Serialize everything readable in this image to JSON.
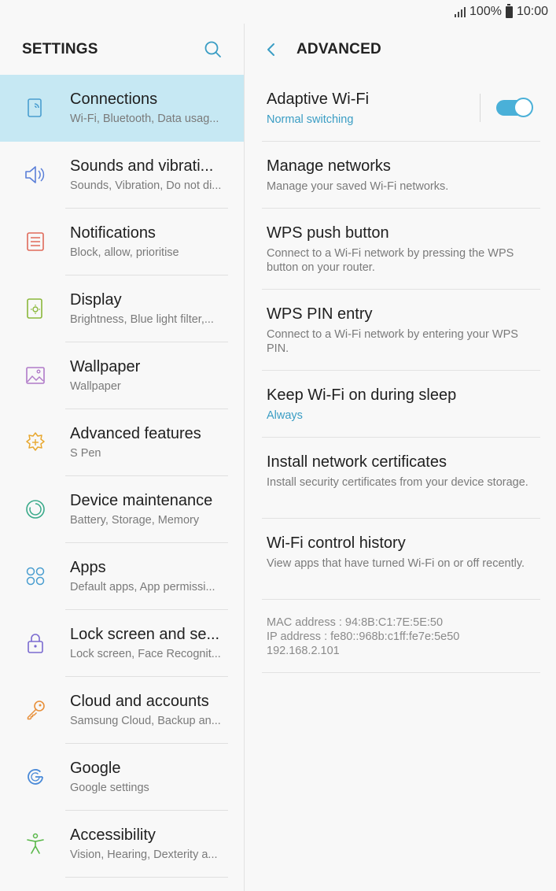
{
  "status_bar": {
    "battery_percent": "100%",
    "time": "10:00"
  },
  "left_panel": {
    "title": "SETTINGS",
    "items": [
      {
        "title": "Connections",
        "subtitle": "Wi-Fi, Bluetooth, Data usag...",
        "icon": "connections-icon",
        "icon_color": "#4a9ed0",
        "selected": true
      },
      {
        "title": "Sounds and vibrati...",
        "subtitle": "Sounds, Vibration, Do not di...",
        "icon": "speaker-icon",
        "icon_color": "#5a7fd8"
      },
      {
        "title": "Notifications",
        "subtitle": "Block, allow, prioritise",
        "icon": "notifications-icon",
        "icon_color": "#e06a5a"
      },
      {
        "title": "Display",
        "subtitle": "Brightness, Blue light filter,...",
        "icon": "display-icon",
        "icon_color": "#8ab83a"
      },
      {
        "title": "Wallpaper",
        "subtitle": "Wallpaper",
        "icon": "wallpaper-icon",
        "icon_color": "#b07ac8"
      },
      {
        "title": "Advanced features",
        "subtitle": "S Pen",
        "icon": "advanced-features-icon",
        "icon_color": "#e8a830"
      },
      {
        "title": "Device maintenance",
        "subtitle": "Battery, Storage, Memory",
        "icon": "device-maintenance-icon",
        "icon_color": "#3aaa8a"
      },
      {
        "title": "Apps",
        "subtitle": "Default apps, App permissi...",
        "icon": "apps-icon",
        "icon_color": "#4a9ed0"
      },
      {
        "title": "Lock screen and se...",
        "subtitle": "Lock screen, Face Recognit...",
        "icon": "lock-icon",
        "icon_color": "#7a6ad0"
      },
      {
        "title": "Cloud and accounts",
        "subtitle": "Samsung Cloud, Backup an...",
        "icon": "key-icon",
        "icon_color": "#e8903a"
      },
      {
        "title": "Google",
        "subtitle": "Google settings",
        "icon": "google-icon",
        "icon_color": "#4a8ad8"
      },
      {
        "title": "Accessibility",
        "subtitle": "Vision, Hearing, Dexterity a...",
        "icon": "accessibility-icon",
        "icon_color": "#5ab84a"
      }
    ]
  },
  "right_panel": {
    "title": "ADVANCED",
    "items": [
      {
        "title": "Adaptive Wi-Fi",
        "subtitle": "Normal switching",
        "accent": true,
        "toggle": true,
        "toggle_on": true,
        "height": 85
      },
      {
        "title": "Manage networks",
        "subtitle": "Manage your saved Wi-Fi networks.",
        "height": 85
      },
      {
        "title": "WPS push button",
        "subtitle": "Connect to a Wi-Fi network by pressing the WPS button on your router.",
        "height": 103
      },
      {
        "title": "WPS PIN entry",
        "subtitle": "Connect to a Wi-Fi network by entering your WPS PIN.",
        "height": 103
      },
      {
        "title": "Keep Wi-Fi on during sleep",
        "subtitle": "Always",
        "accent": true,
        "height": 85
      },
      {
        "title": "Install network certificates",
        "subtitle": "Install security certificates from your device storage.",
        "height": 103
      },
      {
        "title": "Wi-Fi control history",
        "subtitle": "View apps that have turned Wi-Fi on or off recently.",
        "height": 103
      }
    ],
    "info": {
      "mac": "MAC address : 94:8B:C1:7E:5E:50",
      "ip": "IP address : fe80::968b:c1ff:fe7e:5e50",
      "ipv4": "192.168.2.101"
    }
  },
  "colors": {
    "accent": "#3a9dc4",
    "selected_bg": "#c6e8f3",
    "toggle_on": "#4ab0d8"
  }
}
